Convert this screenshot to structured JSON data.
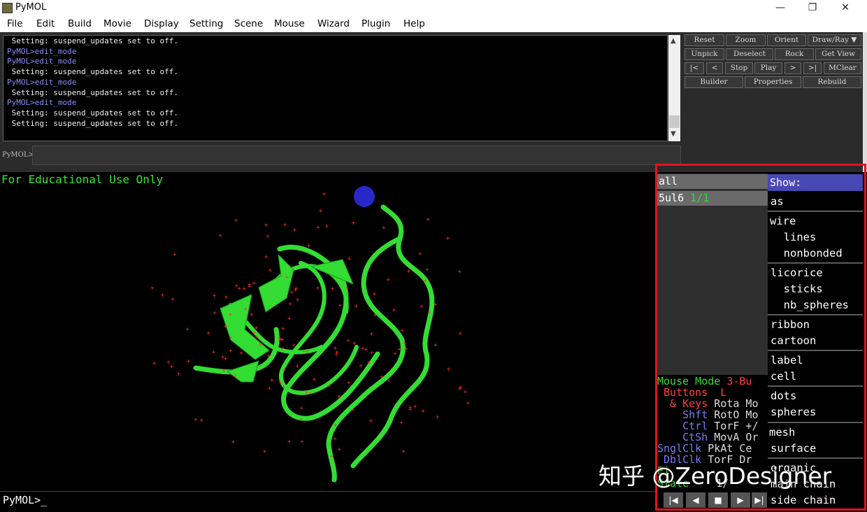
{
  "window": {
    "title": "PyMOL",
    "minimize": "—",
    "maximize": "❐",
    "close": "✕"
  },
  "menubar": [
    "File",
    "Edit",
    "Build",
    "Movie",
    "Display",
    "Setting",
    "Scene",
    "Mouse",
    "Wizard",
    "Plugin",
    "Help"
  ],
  "console": {
    "lines": [
      {
        "text": " Setting: suspend_updates set to off.",
        "kind": "out"
      },
      {
        "text": "PyMOL>edit_mode",
        "kind": "cmd"
      },
      {
        "text": "PyMOL>edit_mode",
        "kind": "cmd"
      },
      {
        "text": " Setting: suspend_updates set to off.",
        "kind": "out"
      },
      {
        "text": "PyMOL>edit_mode",
        "kind": "cmd"
      },
      {
        "text": " Setting: suspend_updates set to off.",
        "kind": "out"
      },
      {
        "text": "PyMOL>edit_mode",
        "kind": "cmd"
      },
      {
        "text": " Setting: suspend_updates set to off.",
        "kind": "out"
      },
      {
        "text": " Setting: suspend_updates set to off.",
        "kind": "out"
      }
    ],
    "prompt_label": "PyMOL>"
  },
  "control_buttons": {
    "row1": [
      "Reset",
      "Zoom",
      "Orient",
      "Draw/Ray ▼"
    ],
    "row2": [
      "Unpick",
      "Deselect",
      "Rock",
      "Get View"
    ],
    "row3": [
      "|<",
      "<",
      "Stop",
      "Play",
      ">",
      ">|",
      "MClear"
    ],
    "row4": [
      "Builder",
      "Properties",
      "Rebuild"
    ]
  },
  "viewer": {
    "overlay_text": "For Educational Use Only",
    "cartoon_color": "#33dd33",
    "solvent_color": "#ff3030",
    "sphere_color": "#2828c8"
  },
  "objects": [
    {
      "name": "all",
      "state": ""
    },
    {
      "name": "5ul6",
      "state": "1/1"
    }
  ],
  "mouse_mode": {
    "title_a": "Mouse Mode ",
    "title_b": "3-Bu",
    "buttons_label": " Buttons  L",
    "rows": [
      {
        "label": "  & Keys ",
        "value": "Rota Mo"
      },
      {
        "label": "    Shft ",
        "value": "RotO Mo"
      },
      {
        "label": "    Ctrl ",
        "value": "TorF +/"
      },
      {
        "label": "    CtSh ",
        "value": "MovA Or"
      },
      {
        "label": "SnglClk ",
        "value": "PkAt Ce"
      },
      {
        "label": " DblClk ",
        "value": "TorF Dr"
      }
    ],
    "picking": "Pi",
    "state_label": "State",
    "state_value": "1/"
  },
  "show_menu": {
    "header": "Show:",
    "groups": [
      [
        "as"
      ],
      [
        "wire",
        "  lines",
        "  nonbonded"
      ],
      [
        "licorice",
        "  sticks",
        "  nb_spheres"
      ],
      [
        "ribbon",
        "cartoon"
      ],
      [
        "label",
        "cell"
      ],
      [
        "dots",
        "spheres"
      ],
      [
        "mesh",
        "surface"
      ],
      [
        "organic",
        "main chain",
        "side chain"
      ]
    ]
  },
  "movie_controls": [
    "|◀",
    "◀",
    "■",
    "▶",
    "▶|"
  ],
  "bottom_prompt": "PyMOL>_",
  "watermark": "知乎 @ZeroDesigner"
}
